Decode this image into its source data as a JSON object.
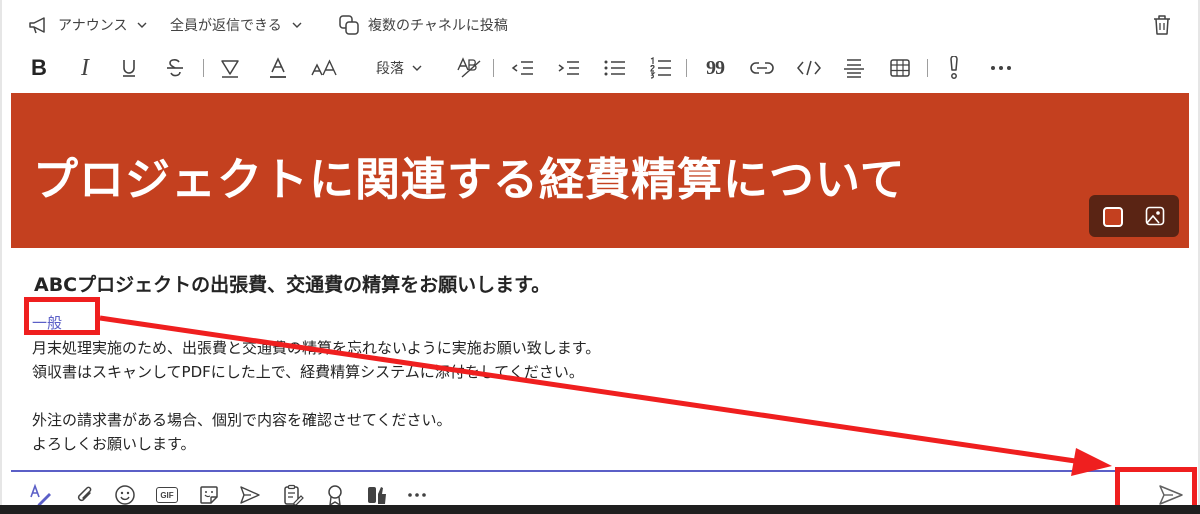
{
  "top_bar": {
    "announcement_label": "アナウンス",
    "reply_setting_label": "全員が返信できる",
    "multi_channel_label": "複数のチャネルに投稿"
  },
  "format_toolbar": {
    "bold_glyph": "B",
    "italic_glyph": "I",
    "paragraph_label": "段落",
    "quote_glyph": "99"
  },
  "banner": {
    "title": "プロジェクトに関連する経費精算について",
    "color": "#c4401f"
  },
  "message": {
    "subject": "ABCプロジェクトの出張費、交通費の精算をお願いします。",
    "channel_tag": "一般",
    "lines": [
      "月末処理実施のため、出張費と交通費の精算を忘れないように実施お願い致します。",
      "領収書はスキャンしてPDFにした上で、経費精算システムに添付をしてください。",
      "",
      "外注の請求書がある場合、個別で内容を確認させてください。",
      "よろしくお願いします。"
    ]
  },
  "colors": {
    "accent": "#5b5fc7",
    "annotation_red": "#ef1f1f"
  }
}
